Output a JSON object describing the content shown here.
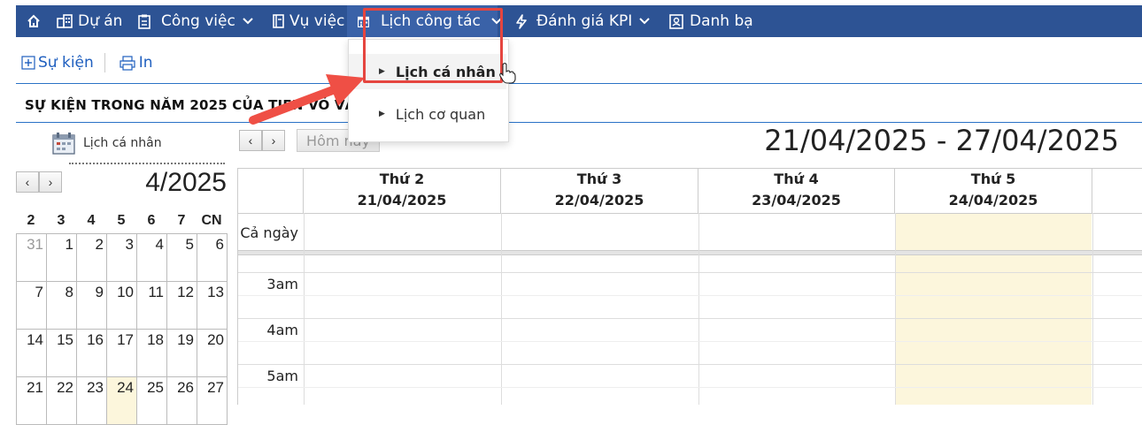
{
  "nav": {
    "items": [
      {
        "icon": "home-icon",
        "label": ""
      },
      {
        "icon": "project-icon",
        "label": "Dự án"
      },
      {
        "icon": "task-icon",
        "label": "Công việc"
      },
      {
        "icon": "case-icon",
        "label": "Vụ việc"
      },
      {
        "icon": "calendar-icon",
        "label": "Lịch công tác"
      },
      {
        "icon": "bolt-icon",
        "label": "Đánh giá KPI"
      },
      {
        "icon": "contact-icon",
        "label": "Danh bạ"
      }
    ]
  },
  "dropdown": {
    "items": [
      {
        "label": "Lịch cá nhân",
        "active": true
      },
      {
        "label": "Lịch cơ quan",
        "active": false
      }
    ]
  },
  "toolbar": {
    "event_label": "Sự kiện",
    "print_label": "In"
  },
  "section_title": "SỰ KIỆN TRONG NĂM 2025 CỦA TIEN VÕ VĂN",
  "left_panel": {
    "calendar_label": "Lịch cá nhân",
    "month_label": "4/2025",
    "weekday_headers": [
      "2",
      "3",
      "4",
      "5",
      "6",
      "7",
      "CN"
    ],
    "weeks": [
      [
        {
          "d": "31",
          "other": true
        },
        {
          "d": "1"
        },
        {
          "d": "2"
        },
        {
          "d": "3"
        },
        {
          "d": "4"
        },
        {
          "d": "5"
        },
        {
          "d": "6"
        }
      ],
      [
        {
          "d": "7"
        },
        {
          "d": "8"
        },
        {
          "d": "9"
        },
        {
          "d": "10"
        },
        {
          "d": "11"
        },
        {
          "d": "12"
        },
        {
          "d": "13"
        }
      ],
      [
        {
          "d": "14"
        },
        {
          "d": "15"
        },
        {
          "d": "16"
        },
        {
          "d": "17"
        },
        {
          "d": "18"
        },
        {
          "d": "19"
        },
        {
          "d": "20"
        }
      ],
      [
        {
          "d": "21"
        },
        {
          "d": "22"
        },
        {
          "d": "23"
        },
        {
          "d": "24",
          "today": true
        },
        {
          "d": "25"
        },
        {
          "d": "26"
        },
        {
          "d": "27"
        }
      ]
    ]
  },
  "week_view": {
    "today_button": "Hôm nay",
    "range": "21/04/2025 - 27/04/2025",
    "all_day_label": "Cả ngày",
    "columns": [
      {
        "day": "Thứ 2",
        "date": "21/04/2025"
      },
      {
        "day": "Thứ 3",
        "date": "22/04/2025"
      },
      {
        "day": "Thứ 4",
        "date": "23/04/2025"
      },
      {
        "day": "Thứ 5",
        "date": "24/04/2025"
      }
    ],
    "time_labels": [
      "3am",
      "4am",
      "5am"
    ],
    "colors": {
      "today_bg": "#fcf6dc",
      "nav_bg": "#2d5394",
      "accent": "#2a72c6",
      "highlight": "#e5453f"
    }
  }
}
